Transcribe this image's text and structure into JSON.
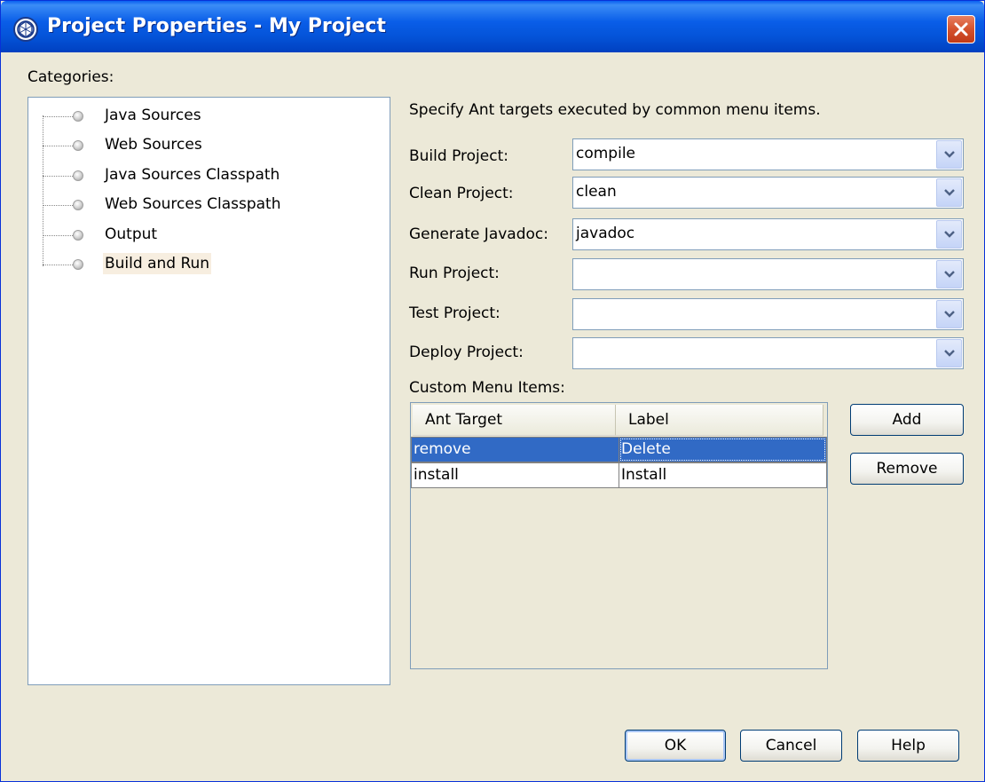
{
  "window": {
    "title": "Project Properties - My Project"
  },
  "categories": {
    "label": "Categories:",
    "items": [
      {
        "label": "Java Sources"
      },
      {
        "label": "Web Sources"
      },
      {
        "label": "Java Sources Classpath"
      },
      {
        "label": "Web Sources Classpath"
      },
      {
        "label": "Output"
      },
      {
        "label": "Build and Run",
        "selected": true
      }
    ]
  },
  "panel": {
    "description": "Specify Ant targets executed by common menu items.",
    "fields": [
      {
        "label": "Build Project:",
        "value": "compile"
      },
      {
        "label": "Clean Project:",
        "value": "clean"
      },
      {
        "label": "Generate Javadoc:",
        "value": "javadoc"
      },
      {
        "label": "Run Project:",
        "value": ""
      },
      {
        "label": "Test Project:",
        "value": ""
      },
      {
        "label": "Deploy Project:",
        "value": ""
      }
    ],
    "custom_menu": {
      "label": "Custom Menu Items:",
      "columns": [
        "Ant Target",
        "Label"
      ],
      "rows": [
        {
          "target": "remove",
          "label": "Delete",
          "selected": true
        },
        {
          "target": "install",
          "label": "Install",
          "selected": false
        }
      ],
      "add_label": "Add",
      "remove_label": "Remove"
    }
  },
  "footer": {
    "ok_label": "OK",
    "cancel_label": "Cancel",
    "help_label": "Help"
  },
  "colors": {
    "selection": "#316ac5",
    "title_bar": "#0a5ee8",
    "close": "#d4522d"
  },
  "icons": {
    "app": "netbeans-logo-icon",
    "close": "close-x-icon",
    "dropdown": "chevron-down-icon",
    "tree_leaf": "bullet-icon"
  }
}
